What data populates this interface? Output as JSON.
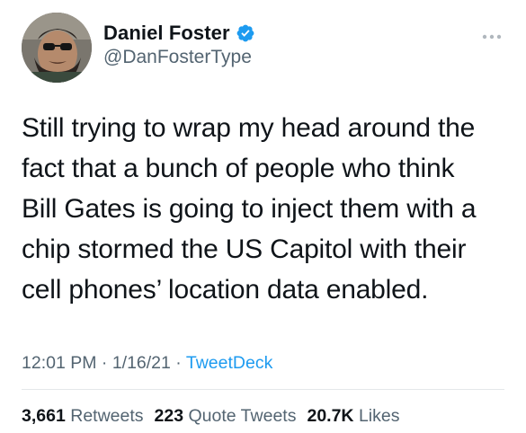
{
  "author": {
    "display_name": "Daniel Foster",
    "handle": "@DanFosterType",
    "verified": true,
    "avatar_icon": "user-avatar-photo"
  },
  "tweet": {
    "lines": [
      "Still trying to wrap my head around the",
      "fact that a bunch of people who think",
      "Bill Gates is going to inject them with a",
      "chip stormed the US Capitol with their",
      "cell phones’ location data enabled."
    ]
  },
  "meta": {
    "time": "12:01 PM",
    "separator": "·",
    "date": "1/16/21",
    "source": "TweetDeck"
  },
  "stats": {
    "retweets_count": "3,661",
    "retweets_label": "Retweets",
    "quotes_count": "223",
    "quotes_label": "Quote Tweets",
    "likes_count": "20.7K",
    "likes_label": "Likes"
  },
  "colors": {
    "text_primary": "#0f1419",
    "text_secondary": "#536471",
    "accent": "#1d9bf0",
    "divider": "#e4e8ea"
  },
  "icons": {
    "verified": "verified-badge-icon",
    "more": "more-options-icon"
  }
}
